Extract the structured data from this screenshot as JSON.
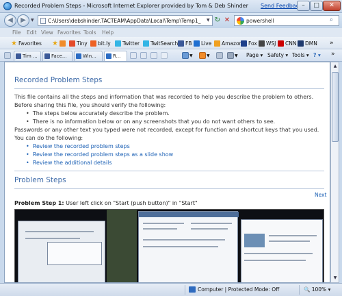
{
  "window": {
    "title": "Recorded Problem Steps - Microsoft Internet Explorer provided by Tom & Deb Shinder",
    "feedback_link": "Send Feedback"
  },
  "address": {
    "url": "C:\\Users\\debshinder.TACTEAM\\AppData\\Local\\Temp\\Temp1_",
    "search_value": "powershell"
  },
  "menu": [
    "File",
    "Edit",
    "View",
    "Favorites",
    "Tools",
    "Help"
  ],
  "favorites": {
    "label": "Favorites",
    "items": [
      {
        "label": "Tiny",
        "color": "#e44b2a"
      },
      {
        "label": "bit.ly",
        "color": "#ee6123"
      },
      {
        "label": "Twitter",
        "color": "#33b5e5"
      },
      {
        "label": "TwitSearch",
        "color": "#33b5e5"
      },
      {
        "label": "FB",
        "color": "#3b5998"
      },
      {
        "label": "Live",
        "color": "#1f6fd1"
      },
      {
        "label": "Amazon",
        "color": "#f0a020"
      },
      {
        "label": "Fox",
        "color": "#1d3f8a"
      },
      {
        "label": "WSJ",
        "color": "#444444"
      },
      {
        "label": "CNN",
        "color": "#cc0000"
      },
      {
        "label": "DMN",
        "color": "#1f3a6e"
      }
    ]
  },
  "tabs": [
    {
      "label": "Tim ...",
      "color": "#3b5998"
    },
    {
      "label": "Face...",
      "color": "#3b5998"
    },
    {
      "label": "Win...",
      "color": "#2b6cc4"
    },
    {
      "label": "R...",
      "color": "#2b6cc4"
    }
  ],
  "commands": {
    "page": "Page",
    "safety": "Safety",
    "tools": "Tools",
    "help": "?"
  },
  "content": {
    "heading": "Recorded Problem Steps",
    "intro_1": "This file contains all the steps and information that was recorded to help you describe the problem to others.",
    "intro_2": "Before sharing this file, you should verify the following:",
    "bullets": [
      "The steps below accurately describe the problem.",
      "There is no information below or on any screenshots that you do not want others to see."
    ],
    "note": "Passwords or any other text you typed were not recorded, except for function and shortcut keys that you used.",
    "can_do": "You can do the following:",
    "links": [
      "Review the recorded problem steps",
      "Review the recorded problem steps as a slide show",
      "Review the additional details"
    ],
    "section_heading": "Problem Steps",
    "next_link": "Next",
    "step_label": "Problem Step 1:",
    "step_text": " User left click on \"Start (push button)\" in \"Start\""
  },
  "status": {
    "zone": "Computer | Protected Mode: Off",
    "zoom": "100%"
  }
}
